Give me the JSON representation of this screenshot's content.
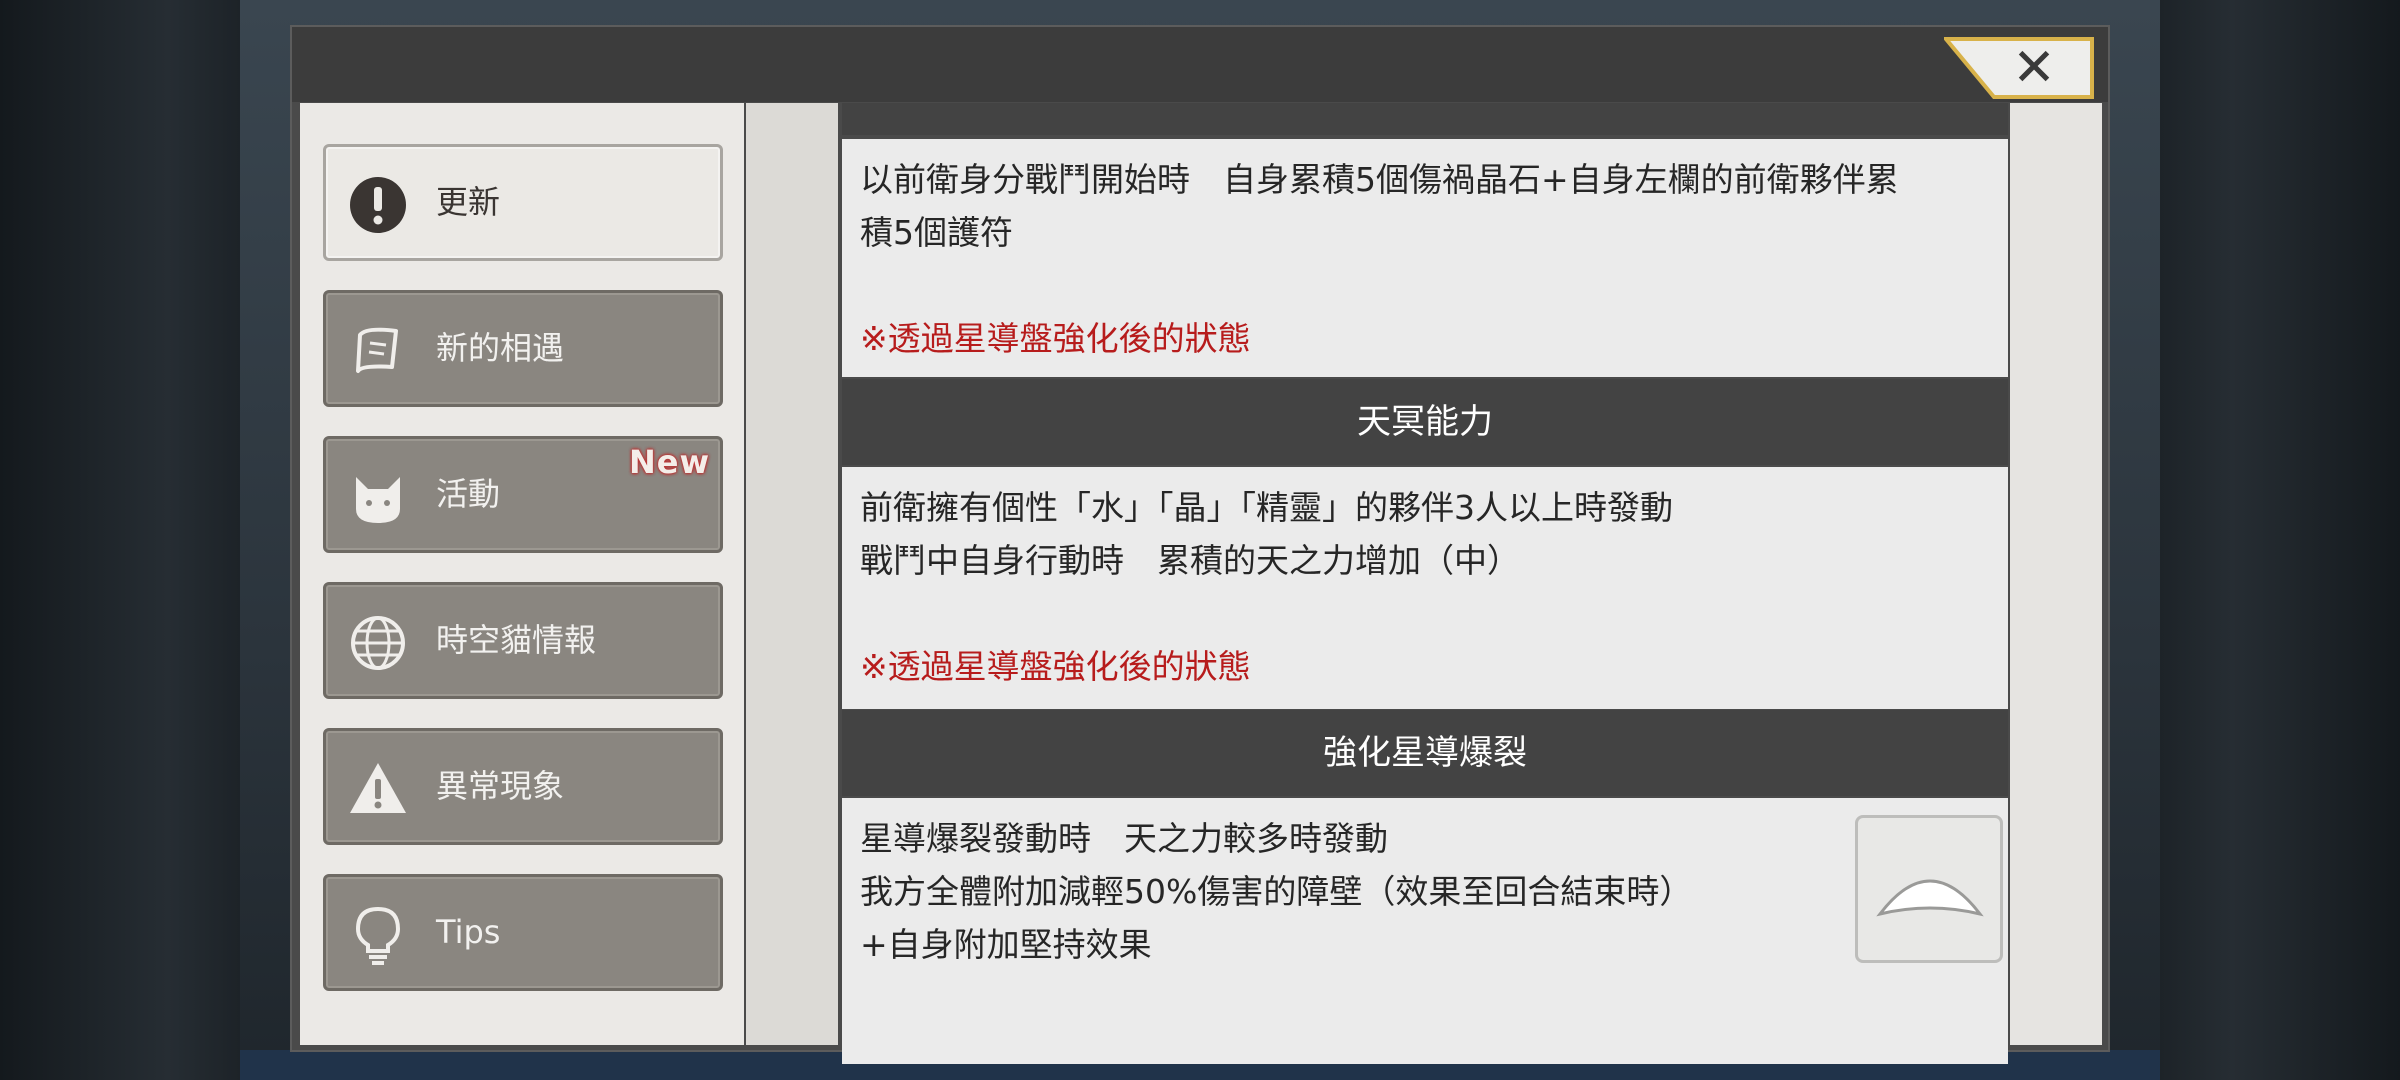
{
  "close": {
    "label": "✕"
  },
  "sidebar": {
    "items": [
      {
        "label": "更新",
        "icon": "exclamation-icon",
        "active": true
      },
      {
        "label": "新的相遇",
        "icon": "scroll-icon",
        "active": false
      },
      {
        "label": "活動",
        "icon": "cat-icon",
        "active": false,
        "badge": "New"
      },
      {
        "label": "時空貓情報",
        "icon": "globe-icon",
        "active": false
      },
      {
        "label": "異常現象",
        "icon": "warning-icon",
        "active": false
      },
      {
        "label": "Tips",
        "icon": "lightbulb-icon",
        "active": false
      }
    ]
  },
  "content": {
    "sections": [
      {
        "header": "",
        "lines": [
          "以前衛身分戰鬥開始時　自身累積5個傷禍晶石+自身左欄的前衛夥伴累",
          "積5個護符"
        ],
        "note": "※透過星導盤強化後的狀態"
      },
      {
        "header": "天冥能力",
        "lines": [
          "前衛擁有個性「水」「晶」「精靈」的夥伴3人以上時發動",
          "戰鬥中自身行動時　累積的天之力增加（中）"
        ],
        "note": "※透過星導盤強化後的狀態"
      },
      {
        "header": "強化星導爆裂",
        "lines": [
          "星導爆裂發動時　天之力較多時發動",
          "我方全體附加減輕50%傷害的障壁（效果至回合結束時）",
          "+自身附加堅持效果"
        ],
        "note": ""
      }
    ]
  },
  "colors": {
    "note": "#b71c1c",
    "section_header": "#434343",
    "close_gold": "#d8b24a"
  }
}
